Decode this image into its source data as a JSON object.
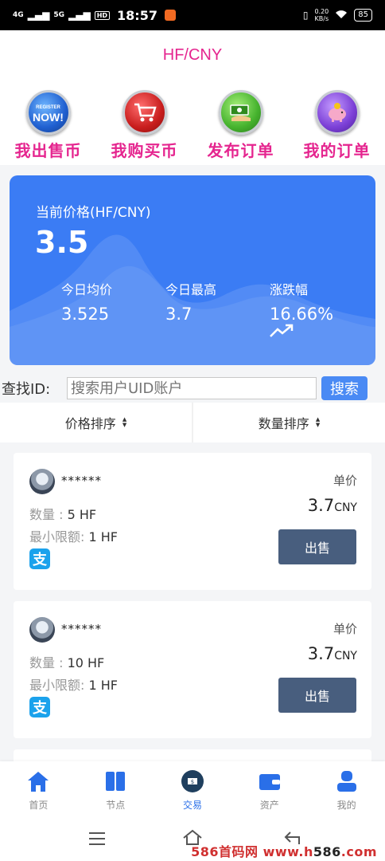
{
  "status_bar": {
    "time": "18:57",
    "signal1": "4G",
    "signal2": "5G",
    "hd": "HD",
    "speed_value": "0.20",
    "speed_unit": "KB/s",
    "battery": "85"
  },
  "header": {
    "title": "HF/CNY"
  },
  "quick_actions": [
    {
      "label": "我出售币",
      "icon": "register-now-icon",
      "icon_text_top": "REGISTER",
      "icon_text": "NOW!"
    },
    {
      "label": "我购买币",
      "icon": "shopping-cart-icon"
    },
    {
      "label": "发布订单",
      "icon": "money-hand-icon"
    },
    {
      "label": "我的订单",
      "icon": "piggy-bank-icon"
    }
  ],
  "price_card": {
    "label": "当前价格(HF/CNY)",
    "value": "3.5",
    "stats": [
      {
        "label": "今日均价",
        "value": "3.525"
      },
      {
        "label": "今日最高",
        "value": "3.7"
      },
      {
        "label": "涨跌幅",
        "value": "16.66%"
      }
    ]
  },
  "search": {
    "label": "查找ID:",
    "placeholder": "搜索用户UID账户",
    "button": "搜索"
  },
  "sort": {
    "price": "价格排序",
    "quantity": "数量排序"
  },
  "orders": [
    {
      "user": "******",
      "qty_label": "数量 :",
      "qty": "5 HF",
      "min_label": "最小限额:",
      "min": "1 HF",
      "pay_icon": "支",
      "unit_label": "单价",
      "price": "3.7",
      "currency": "CNY",
      "action": "出售"
    },
    {
      "user": "******",
      "qty_label": "数量 :",
      "qty": "10 HF",
      "min_label": "最小限额:",
      "min": "1 HF",
      "pay_icon": "支",
      "unit_label": "单价",
      "price": "3.7",
      "currency": "CNY",
      "action": "出售"
    }
  ],
  "bottom_nav": [
    {
      "label": "首页",
      "icon": "home-icon",
      "active": false
    },
    {
      "label": "节点",
      "icon": "book-icon",
      "active": false
    },
    {
      "label": "交易",
      "icon": "exchange-icon",
      "active": true
    },
    {
      "label": "资产",
      "icon": "wallet-icon",
      "active": false
    },
    {
      "label": "我的",
      "icon": "user-icon",
      "active": false
    }
  ],
  "watermark": {
    "red": "586首码网 www.h",
    "dark": "586",
    "red2": ".com"
  },
  "colors": {
    "accent": "#e5258f",
    "card_blue": "#3b7cf4",
    "sell_button": "#485e7e",
    "active_nav": "#2a6fe8"
  }
}
